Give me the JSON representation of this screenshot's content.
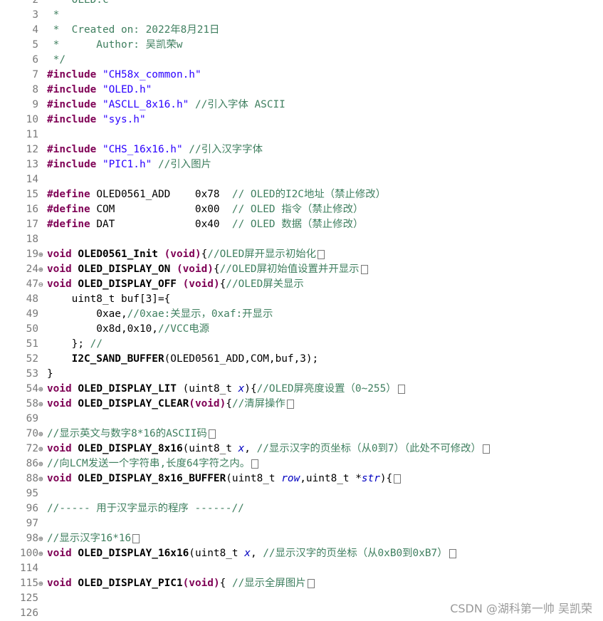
{
  "lines": [
    {
      "num": "2",
      "fold": "",
      "segs": [
        {
          "c": "cm",
          "t": "    OLED.c"
        }
      ]
    },
    {
      "num": "3",
      "fold": "",
      "segs": [
        {
          "c": "cm",
          "t": " *"
        }
      ]
    },
    {
      "num": "4",
      "fold": "",
      "segs": [
        {
          "c": "cm",
          "t": " *  Created on: 2022年8月21日"
        }
      ]
    },
    {
      "num": "5",
      "fold": "",
      "segs": [
        {
          "c": "cm",
          "t": " *      Author: 吴凯荣w"
        }
      ]
    },
    {
      "num": "6",
      "fold": "",
      "segs": [
        {
          "c": "cm",
          "t": " */"
        }
      ]
    },
    {
      "num": "7",
      "fold": "",
      "segs": [
        {
          "c": "kw",
          "t": "#include "
        },
        {
          "c": "str",
          "t": "\"CH58x_common.h\""
        }
      ]
    },
    {
      "num": "8",
      "fold": "",
      "segs": [
        {
          "c": "kw",
          "t": "#include "
        },
        {
          "c": "str",
          "t": "\"OLED.h\""
        }
      ]
    },
    {
      "num": "9",
      "fold": "",
      "segs": [
        {
          "c": "kw",
          "t": "#include "
        },
        {
          "c": "str",
          "t": "\"ASCLL_8x16.h\""
        },
        {
          "c": "cm",
          "t": " //引入字体 ASCII"
        }
      ]
    },
    {
      "num": "10",
      "fold": "",
      "segs": [
        {
          "c": "kw",
          "t": "#include "
        },
        {
          "c": "str",
          "t": "\"sys.h\""
        }
      ]
    },
    {
      "num": "11",
      "fold": "",
      "segs": []
    },
    {
      "num": "12",
      "fold": "",
      "segs": [
        {
          "c": "kw",
          "t": "#include "
        },
        {
          "c": "str",
          "t": "\"CHS_16x16.h\""
        },
        {
          "c": "cm",
          "t": " //引入汉字字体"
        }
      ]
    },
    {
      "num": "13",
      "fold": "",
      "segs": [
        {
          "c": "kw",
          "t": "#include "
        },
        {
          "c": "str",
          "t": "\"PIC1.h\""
        },
        {
          "c": "cm",
          "t": " //引入图片"
        }
      ]
    },
    {
      "num": "14",
      "fold": "",
      "segs": []
    },
    {
      "num": "15",
      "fold": "",
      "segs": [
        {
          "c": "kw",
          "t": "#define "
        },
        {
          "c": "plain",
          "t": "OLED0561_ADD    0x78  "
        },
        {
          "c": "cm",
          "t": "// OLED的I2C地址（禁止修改）"
        }
      ]
    },
    {
      "num": "16",
      "fold": "",
      "segs": [
        {
          "c": "kw",
          "t": "#define "
        },
        {
          "c": "plain",
          "t": "COM             0x00  "
        },
        {
          "c": "cm",
          "t": "// OLED 指令（禁止修改）"
        }
      ]
    },
    {
      "num": "17",
      "fold": "",
      "segs": [
        {
          "c": "kw",
          "t": "#define "
        },
        {
          "c": "plain",
          "t": "DAT             0x40  "
        },
        {
          "c": "cm",
          "t": "// OLED 数据（禁止修改）"
        }
      ]
    },
    {
      "num": "18",
      "fold": "",
      "segs": []
    },
    {
      "num": "19",
      "fold": "⊕",
      "segs": [
        {
          "c": "kw",
          "t": "void "
        },
        {
          "c": "bold",
          "t": "OLED0561_Init "
        },
        {
          "c": "kw",
          "t": "(void)"
        },
        {
          "c": "plain",
          "t": "{"
        },
        {
          "c": "cm",
          "t": "//OLED屏开显示初始化"
        }
      ],
      "box": true
    },
    {
      "num": "24",
      "fold": "⊕",
      "segs": [
        {
          "c": "kw",
          "t": "void "
        },
        {
          "c": "bold",
          "t": "OLED_DISPLAY_ON "
        },
        {
          "c": "kw",
          "t": "(void)"
        },
        {
          "c": "plain",
          "t": "{"
        },
        {
          "c": "cm",
          "t": "//OLED屏初始值设置并开显示"
        }
      ],
      "box": true
    },
    {
      "num": "47",
      "fold": "⊖",
      "segs": [
        {
          "c": "kw",
          "t": "void "
        },
        {
          "c": "bold",
          "t": "OLED_DISPLAY_OFF "
        },
        {
          "c": "kw",
          "t": "(void)"
        },
        {
          "c": "plain",
          "t": "{"
        },
        {
          "c": "cm",
          "t": "//OLED屏关显示"
        }
      ]
    },
    {
      "num": "48",
      "fold": "",
      "segs": [
        {
          "c": "plain",
          "t": "    uint8_t buf[3]={"
        }
      ]
    },
    {
      "num": "49",
      "fold": "",
      "segs": [
        {
          "c": "plain",
          "t": "        0xae,"
        },
        {
          "c": "cm",
          "t": "//0xae:关显示，0xaf:开显示"
        }
      ]
    },
    {
      "num": "50",
      "fold": "",
      "segs": [
        {
          "c": "plain",
          "t": "        0x8d,0x10,"
        },
        {
          "c": "cm",
          "t": "//VCC电源"
        }
      ]
    },
    {
      "num": "51",
      "fold": "",
      "segs": [
        {
          "c": "plain",
          "t": "    }; "
        },
        {
          "c": "cm",
          "t": "//"
        }
      ]
    },
    {
      "num": "52",
      "fold": "",
      "segs": [
        {
          "c": "plain",
          "t": "    "
        },
        {
          "c": "bold",
          "t": "I2C_SAND_BUFFER"
        },
        {
          "c": "plain",
          "t": "(OLED0561_ADD,COM,buf,3);"
        }
      ]
    },
    {
      "num": "53",
      "fold": "",
      "segs": [
        {
          "c": "plain",
          "t": "}"
        }
      ]
    },
    {
      "num": "54",
      "fold": "⊕",
      "segs": [
        {
          "c": "kw",
          "t": "void "
        },
        {
          "c": "bold",
          "t": "OLED_DISPLAY_LIT "
        },
        {
          "c": "plain",
          "t": "(uint8_t "
        },
        {
          "c": "ital",
          "t": "x"
        },
        {
          "c": "plain",
          "t": "){"
        },
        {
          "c": "cm",
          "t": "//OLED屏亮度设置（0~255）"
        }
      ],
      "box": true
    },
    {
      "num": "58",
      "fold": "⊕",
      "segs": [
        {
          "c": "kw",
          "t": "void "
        },
        {
          "c": "bold",
          "t": "OLED_DISPLAY_CLEAR"
        },
        {
          "c": "kw",
          "t": "(void)"
        },
        {
          "c": "plain",
          "t": "{"
        },
        {
          "c": "cm",
          "t": "//清屏操作"
        }
      ],
      "box": true
    },
    {
      "num": "69",
      "fold": "",
      "segs": []
    },
    {
      "num": "70",
      "fold": "⊕",
      "segs": [
        {
          "c": "cm",
          "t": "//显示英文与数字8*16的ASCII码"
        }
      ],
      "box": true
    },
    {
      "num": "72",
      "fold": "⊕",
      "segs": [
        {
          "c": "kw",
          "t": "void "
        },
        {
          "c": "bold",
          "t": "OLED_DISPLAY_8x16"
        },
        {
          "c": "plain",
          "t": "(uint8_t "
        },
        {
          "c": "ital",
          "t": "x"
        },
        {
          "c": "plain",
          "t": ", "
        },
        {
          "c": "cm",
          "t": "//显示汉字的页坐标（从0到7）（此处不可修改）"
        }
      ],
      "box": true
    },
    {
      "num": "86",
      "fold": "⊕",
      "segs": [
        {
          "c": "cm",
          "t": "//向LCM发送一个字符串,长度64字符之内。"
        }
      ],
      "box": true
    },
    {
      "num": "88",
      "fold": "⊕",
      "segs": [
        {
          "c": "kw",
          "t": "void "
        },
        {
          "c": "bold",
          "t": "OLED_DISPLAY_8x16_BUFFER"
        },
        {
          "c": "plain",
          "t": "(uint8_t "
        },
        {
          "c": "ital",
          "t": "row"
        },
        {
          "c": "plain",
          "t": ",uint8_t *"
        },
        {
          "c": "ital",
          "t": "str"
        },
        {
          "c": "plain",
          "t": "){"
        }
      ],
      "box": true
    },
    {
      "num": "95",
      "fold": "",
      "segs": []
    },
    {
      "num": "96",
      "fold": "",
      "segs": [
        {
          "c": "cm",
          "t": "//----- 用于汉字显示的程序 ------//"
        }
      ]
    },
    {
      "num": "97",
      "fold": "",
      "segs": []
    },
    {
      "num": "98",
      "fold": "⊕",
      "segs": [
        {
          "c": "cm",
          "t": "//显示汉字16*16"
        }
      ],
      "box": true
    },
    {
      "num": "100",
      "fold": "⊕",
      "segs": [
        {
          "c": "kw",
          "t": "void "
        },
        {
          "c": "bold",
          "t": "OLED_DISPLAY_16x16"
        },
        {
          "c": "plain",
          "t": "(uint8_t "
        },
        {
          "c": "ital",
          "t": "x"
        },
        {
          "c": "plain",
          "t": ", "
        },
        {
          "c": "cm",
          "t": "//显示汉字的页坐标（从0xB0到0xB7）"
        }
      ],
      "box": true
    },
    {
      "num": "114",
      "fold": "",
      "segs": []
    },
    {
      "num": "115",
      "fold": "⊕",
      "segs": [
        {
          "c": "kw",
          "t": "void "
        },
        {
          "c": "bold",
          "t": "OLED_DISPLAY_PIC1"
        },
        {
          "c": "kw",
          "t": "(void)"
        },
        {
          "c": "plain",
          "t": "{ "
        },
        {
          "c": "cm",
          "t": "//显示全屏图片"
        }
      ],
      "box": true
    },
    {
      "num": "125",
      "fold": "",
      "segs": []
    },
    {
      "num": "126",
      "fold": "",
      "segs": []
    }
  ],
  "watermark": "CSDN @湖科第一帅 吴凯荣"
}
